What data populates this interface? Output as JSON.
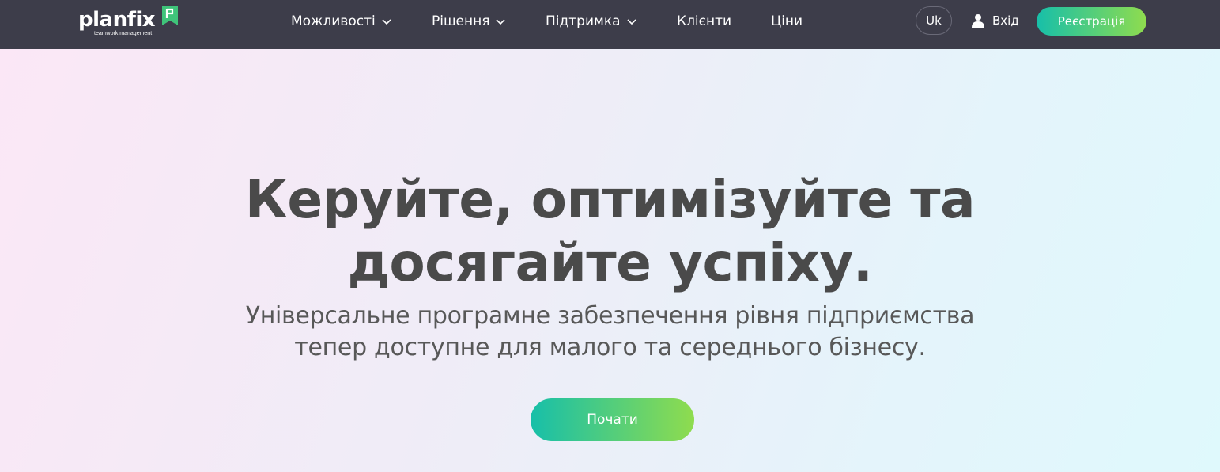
{
  "nav": {
    "logo": {
      "name": "planfix",
      "tagline": "teamwork management"
    },
    "menu": [
      {
        "label": "Можливості",
        "dropdown": true
      },
      {
        "label": "Рішення",
        "dropdown": true
      },
      {
        "label": "Підтримка",
        "dropdown": true
      },
      {
        "label": "Клієнти",
        "dropdown": false
      },
      {
        "label": "Ціни",
        "dropdown": false
      }
    ],
    "language": "Uk",
    "login_label": "Вхід",
    "register_label": "Реєстрація"
  },
  "hero": {
    "headline_line1": "Керуйте, оптимізуйте та",
    "headline_line2": "досягайте успіху.",
    "subtitle_line1": "Універсальне програмне забезпечення рівня підприємства",
    "subtitle_line2": "тепер доступне для малого та середнього бізнесу.",
    "cta_label": "Почати"
  },
  "colors": {
    "nav_bg": "#3d3d4a",
    "accent_start": "#17bfa9",
    "accent_end": "#8fdc4e",
    "text": "#4a4a4a"
  },
  "icons": [
    "flag-icon",
    "chevron-down-icon",
    "user-icon"
  ]
}
